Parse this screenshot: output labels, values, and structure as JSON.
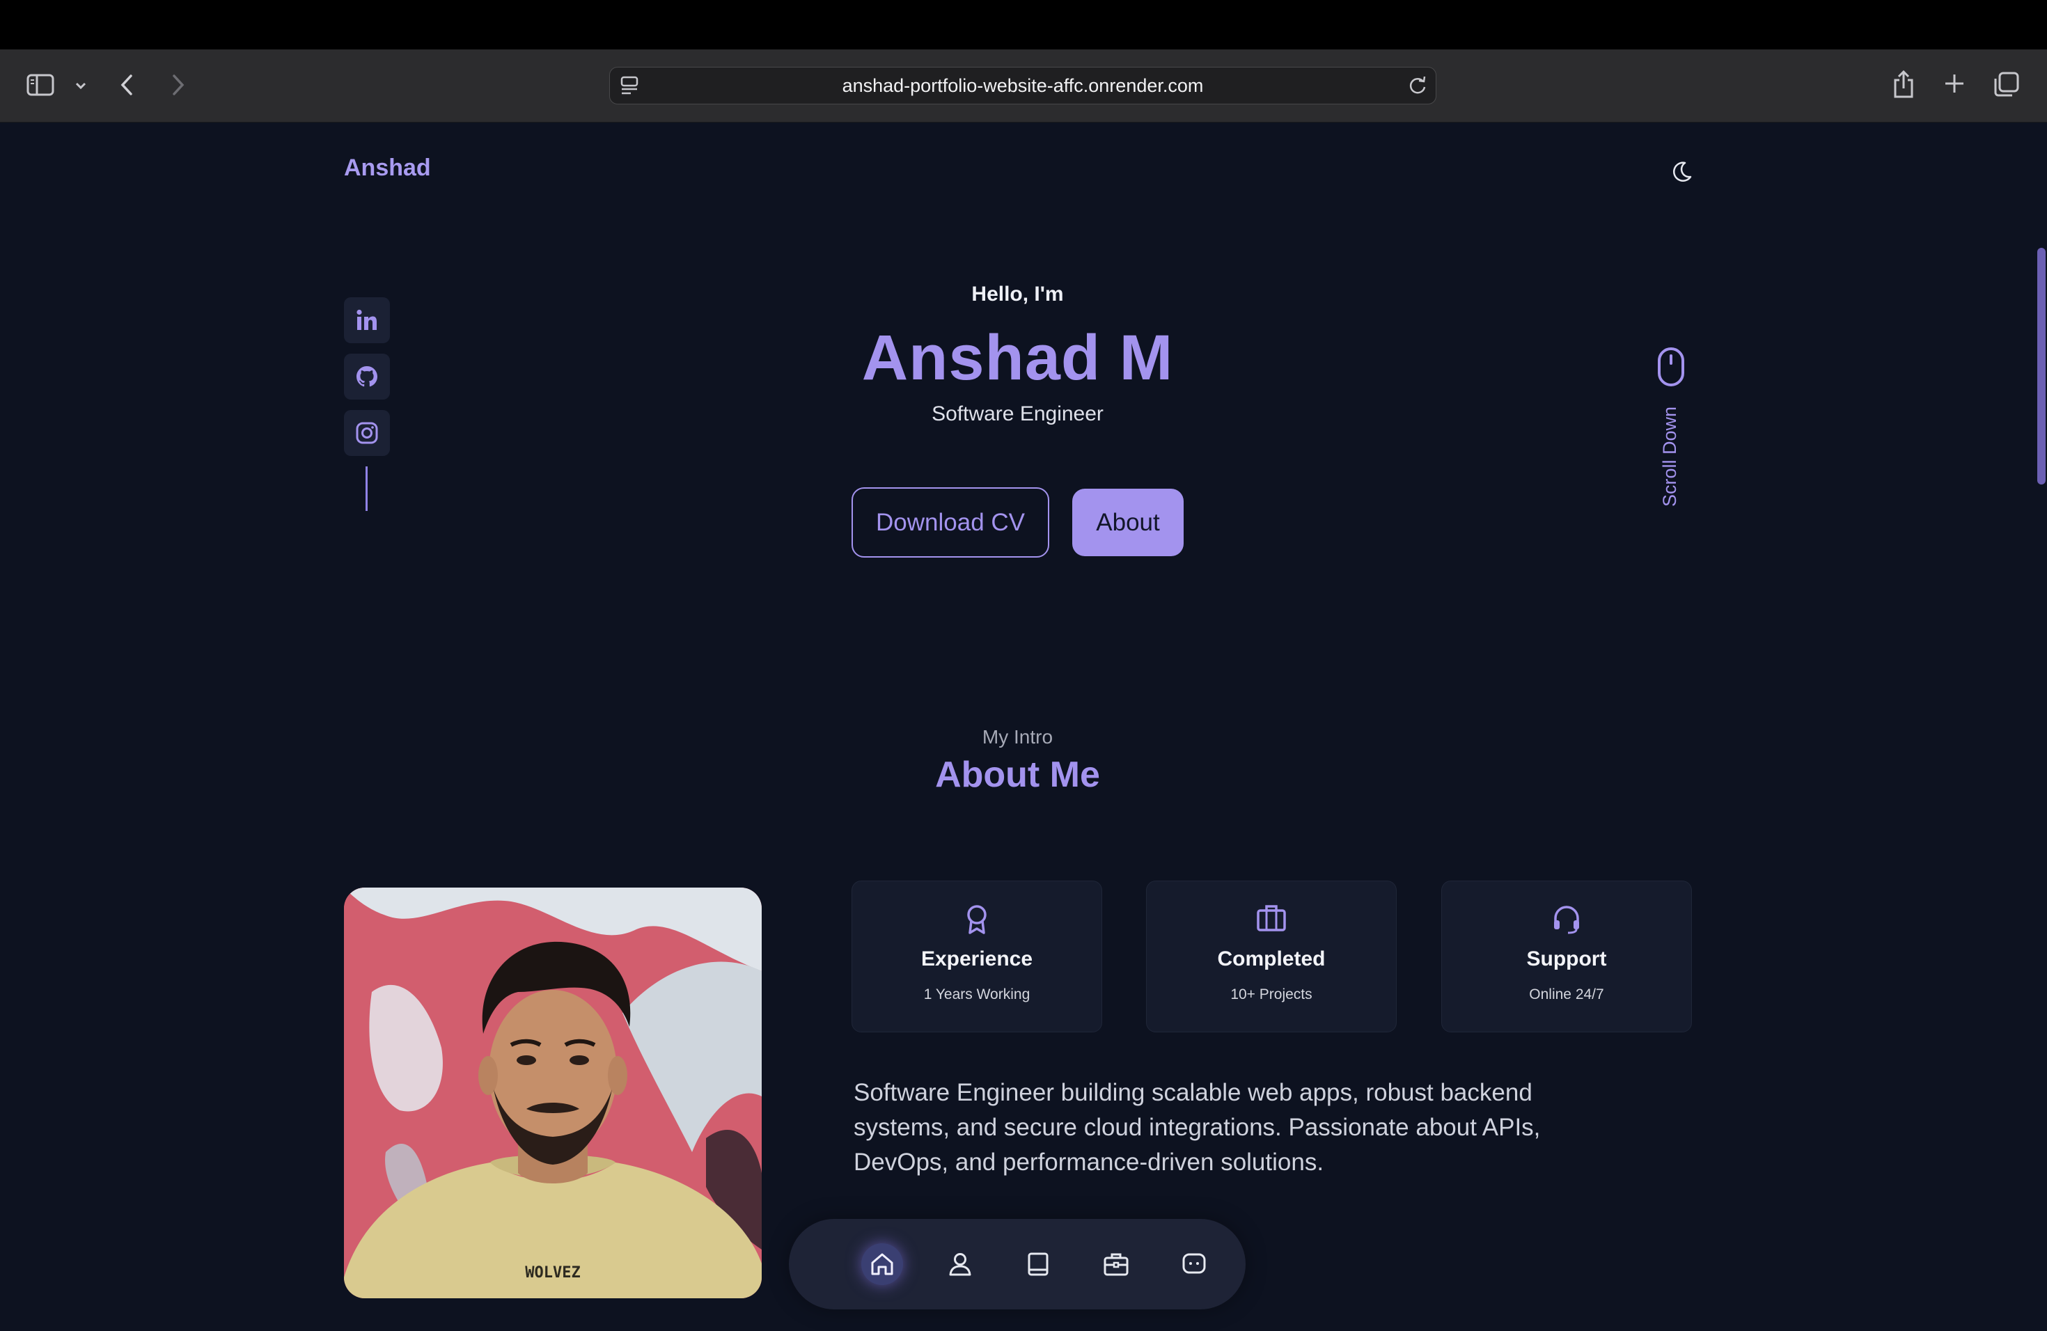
{
  "browser": {
    "url": "anshad-portfolio-website-affc.onrender.com"
  },
  "header": {
    "brand": "Anshad"
  },
  "hero": {
    "greeting": "Hello, I'm",
    "name": "Anshad M",
    "role": "Software Engineer",
    "download_cv_label": "Download CV",
    "about_label": "About",
    "scroll_label": "Scroll Down"
  },
  "socials": [
    {
      "name": "linkedin-icon"
    },
    {
      "name": "github-icon"
    },
    {
      "name": "instagram-icon"
    }
  ],
  "about": {
    "subtitle": "My Intro",
    "title": "About Me",
    "photo_shirt_text": "WOLVEZ",
    "cards": [
      {
        "icon": "award-icon",
        "title": "Experience",
        "subtitle": "1 Years Working"
      },
      {
        "icon": "briefcase-icon",
        "title": "Completed",
        "subtitle": "10+ Projects"
      },
      {
        "icon": "headset-icon",
        "title": "Support",
        "subtitle": "Online 24/7"
      }
    ],
    "description": "Software Engineer building scalable web apps, robust backend systems, and secure cloud integrations. Passionate about APIs, DevOps, and performance-driven solutions."
  },
  "bottom_nav": {
    "items": [
      "home-icon",
      "user-icon",
      "book-icon",
      "briefcase-icon",
      "message-icon"
    ],
    "active": "home-icon"
  },
  "colors": {
    "background": "#0d1220",
    "accent": "#a393ee",
    "card": "#151b2c"
  }
}
